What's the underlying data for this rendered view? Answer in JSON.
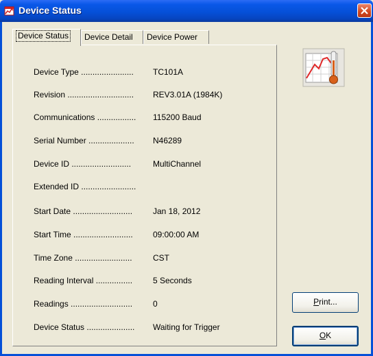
{
  "window": {
    "title": "Device Status",
    "app_icon": "red-chart-icon",
    "close_icon": "close-x-icon",
    "accent": "#0550d8",
    "close_color": "#d1461d"
  },
  "tabs": [
    {
      "label": "Device Status",
      "active": true
    },
    {
      "label": "Device Detail",
      "active": false
    },
    {
      "label": "Device Power",
      "active": false
    }
  ],
  "status": {
    "rows": [
      {
        "label": "Device Type .......................",
        "value": "TC101A"
      },
      {
        "label": "Revision .............................",
        "value": "REV3.01A (1984K)"
      },
      {
        "label": "Communications .................",
        "value": "115200 Baud"
      },
      {
        "label": "Serial Number ....................",
        "value": "N46289"
      },
      {
        "label": "Device ID ..........................",
        "value": "MultiChannel"
      },
      {
        "label": "Extended ID ........................",
        "value": ""
      },
      {
        "label": "Start Date ..........................",
        "value": "Jan 18, 2012"
      },
      {
        "label": "Start Time ..........................",
        "value": "09:00:00 AM"
      },
      {
        "label": "Time Zone .........................",
        "value": "CST"
      },
      {
        "label": "Reading Interval ................",
        "value": "5 Seconds"
      },
      {
        "label": "Readings ...........................",
        "value": "0"
      },
      {
        "label": "Device Status .....................",
        "value": "Waiting for Trigger"
      }
    ]
  },
  "side": {
    "device_icon": "thermometer-chart-icon"
  },
  "buttons": {
    "print_label_u": "P",
    "print_label_rest": "rint...",
    "ok_label_u": "O",
    "ok_label_rest": "K"
  }
}
